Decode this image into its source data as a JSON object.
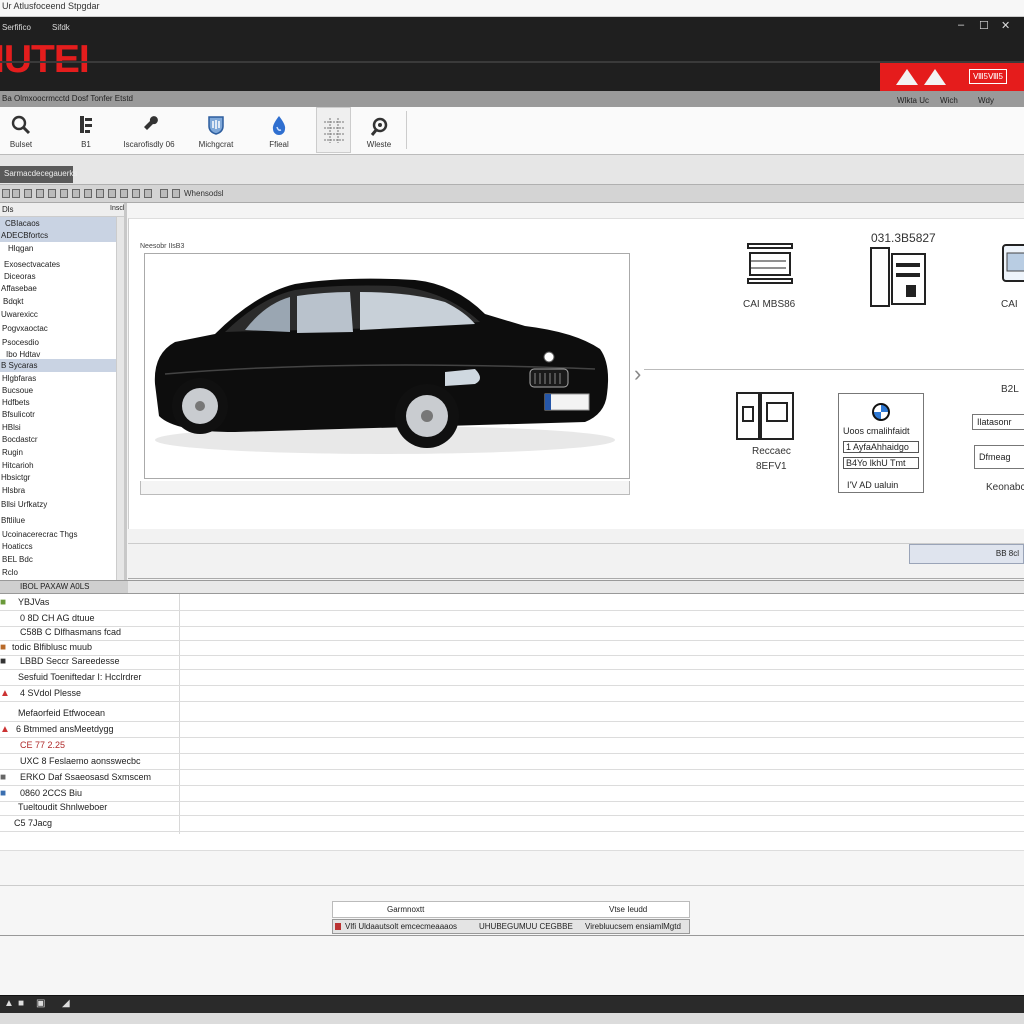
{
  "window": {
    "title": "Ur Atlusfoceend Stpgdar",
    "menus": [
      "Serfifico",
      "Sifdk"
    ],
    "controls": [
      "–",
      "☐",
      "✕"
    ]
  },
  "brand": {
    "logo": "IUTEI",
    "red_button": "Ⅷ5Ⅷ5",
    "accent": "#e51c1c"
  },
  "subbar": {
    "text": "Ba Olmxoocrmcctd Dosf Tonfer Etstd",
    "nav": [
      "Wlkta Uc",
      "Wich",
      "Wdy"
    ]
  },
  "toolbar": {
    "items": [
      {
        "label": "Bulset",
        "icon": "magnifier-icon"
      },
      {
        "label": "B1",
        "icon": "document-icon"
      },
      {
        "label": "Iscarofisdly 06",
        "icon": "wrench-icon"
      },
      {
        "label": "Michgcrat",
        "icon": "shield-icon"
      },
      {
        "label": "Ffieal",
        "icon": "droplet-icon"
      },
      {
        "label": "",
        "icon": "grid-icon"
      },
      {
        "label": "Wleste",
        "icon": "gear-wrench-icon"
      }
    ]
  },
  "tab": {
    "label": "Sarmacdecegauerks"
  },
  "iconrow": {
    "label": "Whensodsl"
  },
  "sidebar": {
    "header_left": "Dls",
    "header_right": "Inscl",
    "items": [
      "CBIacaos",
      "ADECBfortcs",
      "Hlqgan",
      "Exosectvacates",
      "Diceoras",
      "Affasebae",
      "Bdqkt",
      "Uwarexicc",
      "Pogvxaoctac",
      "Psocesdio",
      "Ibo Hdtav",
      "B Sycaras",
      "Hlgbfaras",
      "Bucsoue",
      "Hdfbets",
      "Bfsulicotr",
      "HBlsi",
      "Bocdastcr",
      "Rugin",
      "Hitcarioh",
      "Hbsictgr",
      "Hlsbra",
      "Bllsi Urfkatzy",
      "Bftlilue",
      "Ucoinacerecrac Thgs",
      "Hoaticcs",
      "BEL Bdc",
      "Rclo"
    ]
  },
  "main": {
    "caption": "Neesobr IIsB3",
    "right": {
      "code": "031.3B5827",
      "cap_label": "CAI MBS86",
      "cap2": "CAI",
      "cap3": "Reccaec",
      "cap4": "8EFV1",
      "badge_lines": [
        "Uoos cmalihfaidt",
        "1 AyfaAhhaidgo",
        "B4Yo lkhU Tmt",
        "I'V AD ualuin"
      ],
      "side_code": "B2L",
      "btn1": "Ilatasonr",
      "btn2": "Dfmeag",
      "cap5": "Keonabc"
    }
  },
  "below": {
    "button": "BB 8cl"
  },
  "listheader": {
    "label": "IBOL PAXAW A0LS"
  },
  "list": {
    "rows": [
      {
        "text": "YBJVas",
        "indent": 18
      },
      {
        "text": "0 8D CH AG dtuue",
        "indent": 20
      },
      {
        "text": "C58B C Dlfhasmans fcad",
        "indent": 20
      },
      {
        "text": "todic Blfiblusc muub",
        "indent": 12
      },
      {
        "text": "LBBD Seccr Sareedesse",
        "indent": 20
      },
      {
        "text": "Sesfuid Toeniftedar I: Hcclrdrer",
        "indent": 18
      },
      {
        "text": "4 SVdol Plesse",
        "indent": 20
      },
      {
        "text": "Mefaorfeid Etfwocean",
        "indent": 18
      },
      {
        "text": "6 Btmmed ansMeetdygg",
        "indent": 16
      },
      {
        "text": "CE 77 2.25",
        "indent": 20
      },
      {
        "text": "UXC 8 Feslaemo aonsswecbc",
        "indent": 20
      },
      {
        "text": "ERKO Daf Ssaeosasd Sxmscem",
        "indent": 20
      },
      {
        "text": "0860 2CCS Biu",
        "indent": 20
      },
      {
        "text": "Tueltoudit Shnlweboer",
        "indent": 18
      },
      {
        "text": "C5 7Jacg",
        "indent": 14
      }
    ]
  },
  "bottom": {
    "strip1_left": "Garmnoxtt",
    "strip1_right": "Vtse Ieudd",
    "strip2": [
      "Vlfi Uldaautsolt emcecmeaaaos",
      "UHUBEGUMUU CEGBBE",
      "Virebluucsem ensiamlMgtd"
    ]
  }
}
